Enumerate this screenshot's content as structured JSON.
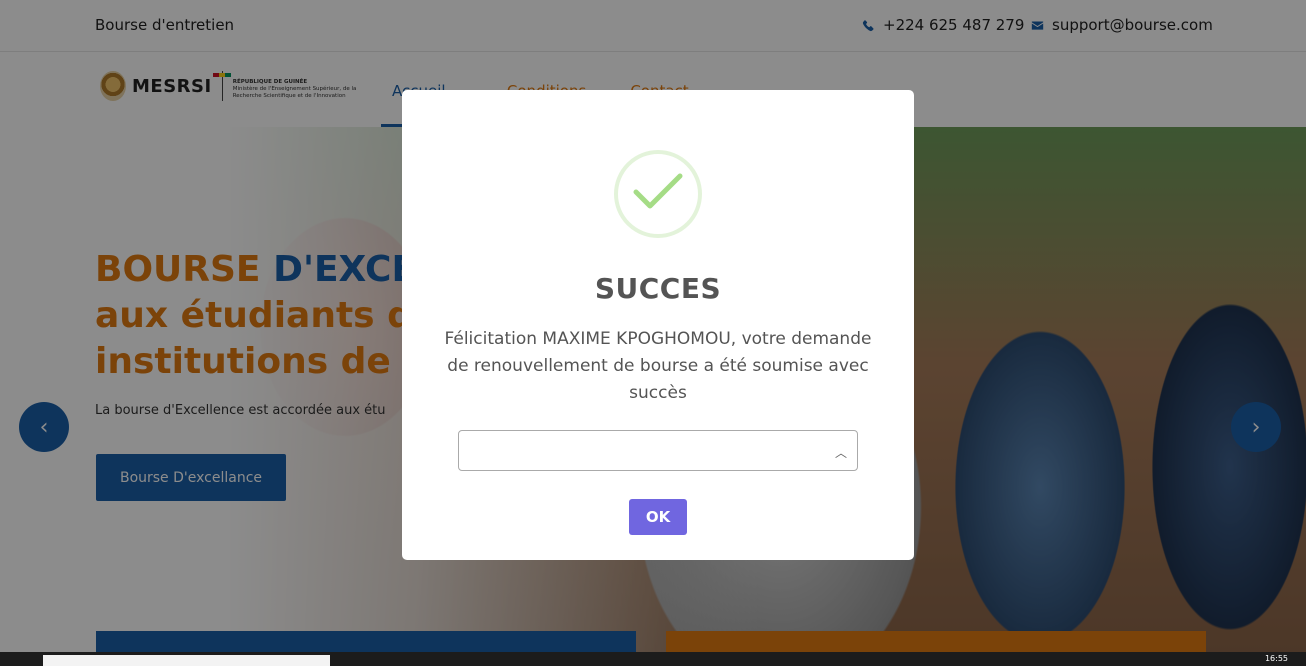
{
  "topbar": {
    "site_name": "Bourse d'entretien",
    "phone": "+224 625 487 279",
    "email": "support@bourse.com",
    "phone_icon": "phone-icon",
    "email_icon": "envelope-icon"
  },
  "logo": {
    "name": "MESRSI",
    "republic": "RÉPUBLIQUE DE GUINÉE",
    "ministry": "Ministère de l'Enseignement Supérieur, de la Recherche Scientifique et de l'Innovation"
  },
  "nav": {
    "items": [
      {
        "label": "Accueil ⌄",
        "active": true
      },
      {
        "label": "Conditions",
        "active": false
      },
      {
        "label": "Contact",
        "active": false
      }
    ]
  },
  "hero": {
    "title_orange_1": "BOURSE ",
    "title_blue_1": "D'EXCEL",
    "title_line2": "aux étudiants d",
    "title_line3": "institutions de f",
    "text": "La bourse d'Excellence est accordée aux étu",
    "button_label": "Bourse D'excellance",
    "prev_icon": "chevron-left-icon",
    "next_icon": "chevron-right-icon"
  },
  "modal": {
    "title": "SUCCES",
    "message": "Félicitation MAXIME KPOGHOMOU, votre demande de renouvellement de bourse a été soumise avec succès",
    "select_value": "",
    "ok_label": "OK",
    "icon": "success-check-icon"
  },
  "taskbar": {
    "clock": "16:55"
  },
  "colors": {
    "brand_blue": "#1a5fa8",
    "brand_orange": "#e07a12",
    "ok_button": "#7066e0",
    "success_green": "#a5dc86"
  }
}
